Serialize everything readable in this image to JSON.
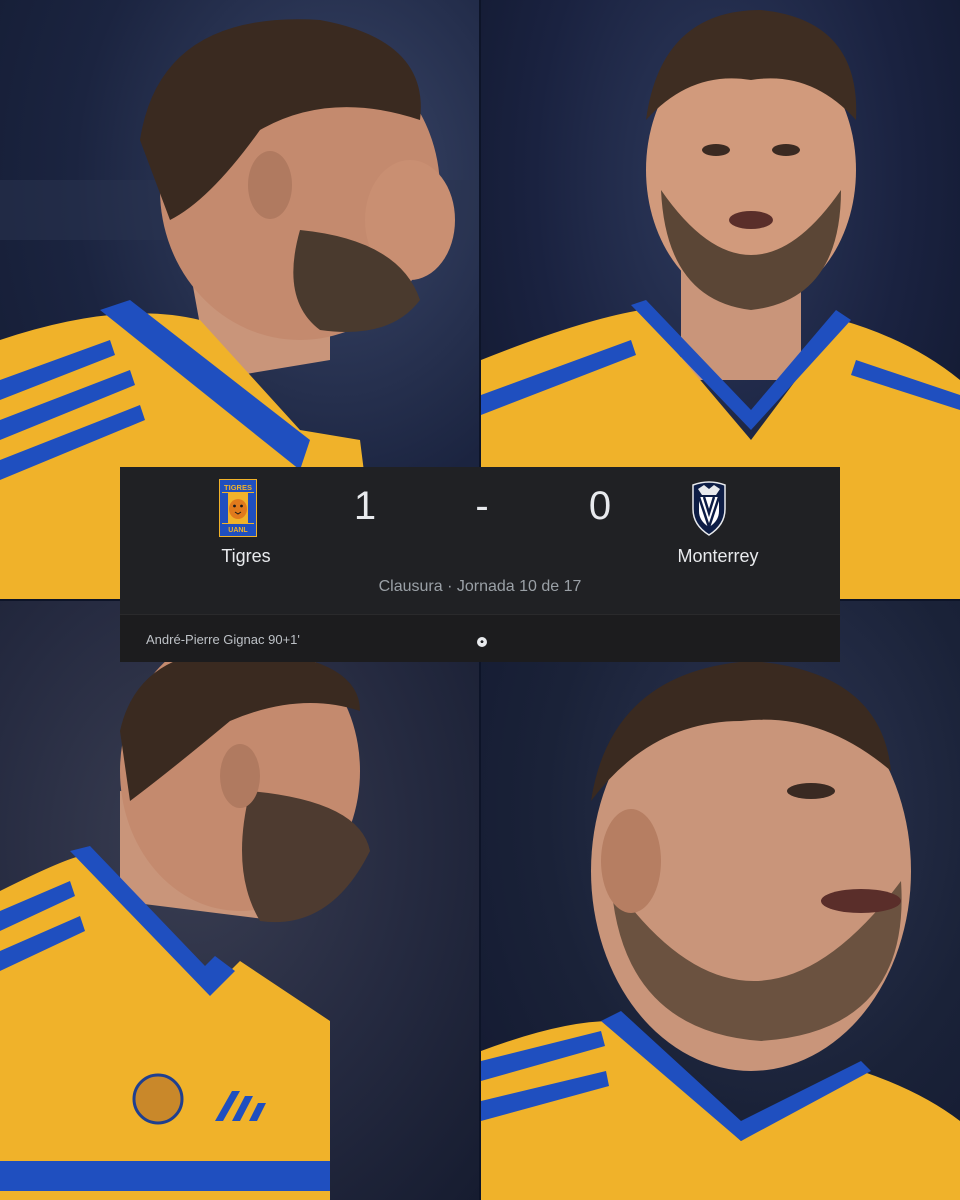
{
  "match": {
    "home": {
      "name": "Tigres",
      "score": "1",
      "logo_text_top": "TIGRES",
      "logo_text_bottom": "UANL",
      "logo_icon": "tigres-crest-icon"
    },
    "away": {
      "name": "Monterrey",
      "score": "0",
      "logo_icon": "monterrey-crest-icon"
    },
    "separator": "-",
    "competition": "Clausura · Jornada 10 de 17",
    "scorer": "André-Pierre Gignac 90+1'",
    "goal_icon": "soccer-ball-icon"
  },
  "colors": {
    "card_bg": "#202124",
    "jersey_yellow": "#f0b22a",
    "jersey_blue": "#1f4fbf",
    "text_primary": "#e8eaed",
    "text_secondary": "#9aa0a6"
  }
}
